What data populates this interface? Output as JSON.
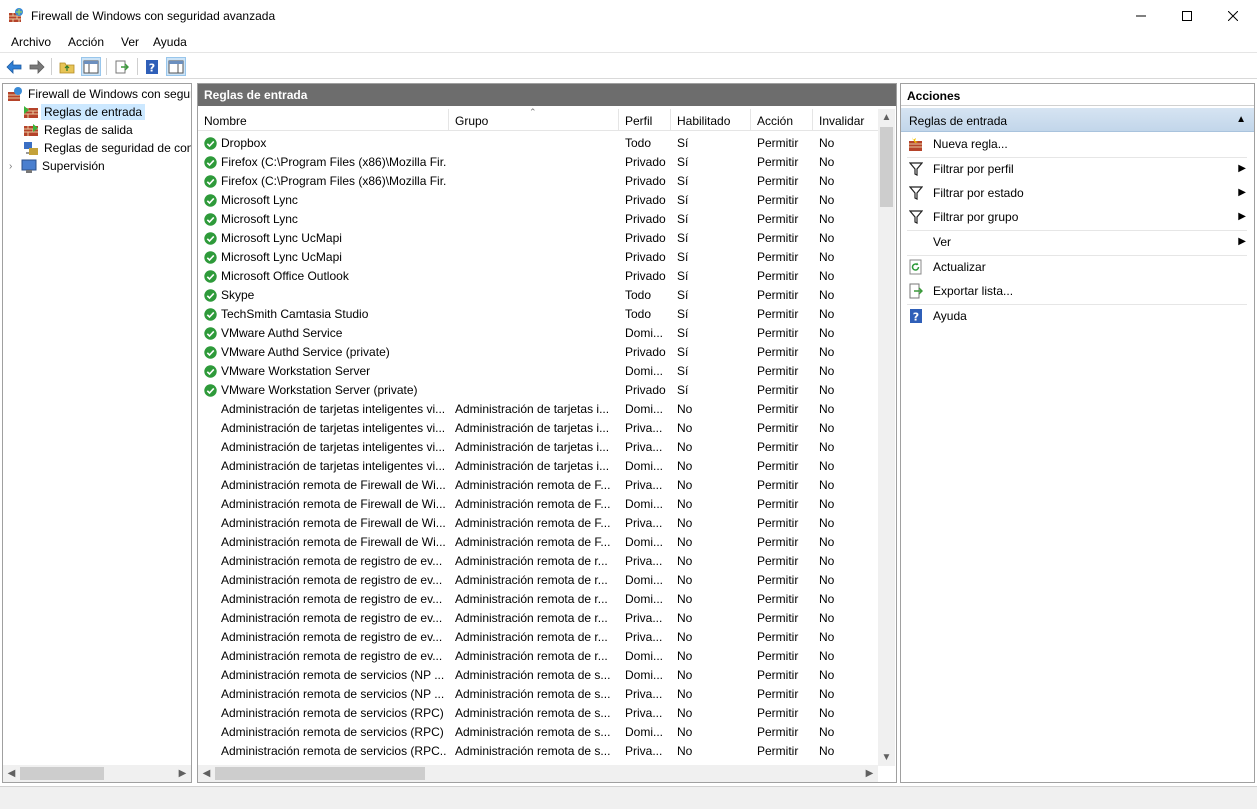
{
  "window": {
    "title": "Firewall de Windows con seguridad avanzada"
  },
  "menu": [
    "Archivo",
    "Acción",
    "Ver",
    "Ayuda"
  ],
  "tree": {
    "root": "Firewall de Windows con segur",
    "items": [
      "Reglas de entrada",
      "Reglas de salida",
      "Reglas de seguridad de con",
      "Supervisión"
    ]
  },
  "center": {
    "header": "Reglas de entrada",
    "columns": [
      "Nombre",
      "Grupo",
      "Perfil",
      "Habilitado",
      "Acción",
      "Invalidar"
    ],
    "rows": [
      {
        "enabled": true,
        "name": "Dropbox",
        "group": "",
        "profile": "Todo",
        "enabled_text": "Sí",
        "action": "Permitir",
        "override": "No"
      },
      {
        "enabled": true,
        "name": "Firefox (C:\\Program Files (x86)\\Mozilla Fir...",
        "group": "",
        "profile": "Privado",
        "enabled_text": "Sí",
        "action": "Permitir",
        "override": "No"
      },
      {
        "enabled": true,
        "name": "Firefox (C:\\Program Files (x86)\\Mozilla Fir...",
        "group": "",
        "profile": "Privado",
        "enabled_text": "Sí",
        "action": "Permitir",
        "override": "No"
      },
      {
        "enabled": true,
        "name": "Microsoft Lync",
        "group": "",
        "profile": "Privado",
        "enabled_text": "Sí",
        "action": "Permitir",
        "override": "No"
      },
      {
        "enabled": true,
        "name": "Microsoft Lync",
        "group": "",
        "profile": "Privado",
        "enabled_text": "Sí",
        "action": "Permitir",
        "override": "No"
      },
      {
        "enabled": true,
        "name": "Microsoft Lync UcMapi",
        "group": "",
        "profile": "Privado",
        "enabled_text": "Sí",
        "action": "Permitir",
        "override": "No"
      },
      {
        "enabled": true,
        "name": "Microsoft Lync UcMapi",
        "group": "",
        "profile": "Privado",
        "enabled_text": "Sí",
        "action": "Permitir",
        "override": "No"
      },
      {
        "enabled": true,
        "name": "Microsoft Office Outlook",
        "group": "",
        "profile": "Privado",
        "enabled_text": "Sí",
        "action": "Permitir",
        "override": "No"
      },
      {
        "enabled": true,
        "name": "Skype",
        "group": "",
        "profile": "Todo",
        "enabled_text": "Sí",
        "action": "Permitir",
        "override": "No"
      },
      {
        "enabled": true,
        "name": "TechSmith Camtasia Studio",
        "group": "",
        "profile": "Todo",
        "enabled_text": "Sí",
        "action": "Permitir",
        "override": "No"
      },
      {
        "enabled": true,
        "name": "VMware Authd Service",
        "group": "",
        "profile": "Domi...",
        "enabled_text": "Sí",
        "action": "Permitir",
        "override": "No"
      },
      {
        "enabled": true,
        "name": "VMware Authd Service (private)",
        "group": "",
        "profile": "Privado",
        "enabled_text": "Sí",
        "action": "Permitir",
        "override": "No"
      },
      {
        "enabled": true,
        "name": "VMware Workstation Server",
        "group": "",
        "profile": "Domi...",
        "enabled_text": "Sí",
        "action": "Permitir",
        "override": "No"
      },
      {
        "enabled": true,
        "name": "VMware Workstation Server (private)",
        "group": "",
        "profile": "Privado",
        "enabled_text": "Sí",
        "action": "Permitir",
        "override": "No"
      },
      {
        "enabled": false,
        "name": "Administración de tarjetas inteligentes vi...",
        "group": "Administración de tarjetas i...",
        "profile": "Domi...",
        "enabled_text": "No",
        "action": "Permitir",
        "override": "No"
      },
      {
        "enabled": false,
        "name": "Administración de tarjetas inteligentes vi...",
        "group": "Administración de tarjetas i...",
        "profile": "Priva...",
        "enabled_text": "No",
        "action": "Permitir",
        "override": "No"
      },
      {
        "enabled": false,
        "name": "Administración de tarjetas inteligentes vi...",
        "group": "Administración de tarjetas i...",
        "profile": "Priva...",
        "enabled_text": "No",
        "action": "Permitir",
        "override": "No"
      },
      {
        "enabled": false,
        "name": "Administración de tarjetas inteligentes vi...",
        "group": "Administración de tarjetas i...",
        "profile": "Domi...",
        "enabled_text": "No",
        "action": "Permitir",
        "override": "No"
      },
      {
        "enabled": false,
        "name": "Administración remota de Firewall de Wi...",
        "group": "Administración remota de F...",
        "profile": "Priva...",
        "enabled_text": "No",
        "action": "Permitir",
        "override": "No"
      },
      {
        "enabled": false,
        "name": "Administración remota de Firewall de Wi...",
        "group": "Administración remota de F...",
        "profile": "Domi...",
        "enabled_text": "No",
        "action": "Permitir",
        "override": "No"
      },
      {
        "enabled": false,
        "name": "Administración remota de Firewall de Wi...",
        "group": "Administración remota de F...",
        "profile": "Priva...",
        "enabled_text": "No",
        "action": "Permitir",
        "override": "No"
      },
      {
        "enabled": false,
        "name": "Administración remota de Firewall de Wi...",
        "group": "Administración remota de F...",
        "profile": "Domi...",
        "enabled_text": "No",
        "action": "Permitir",
        "override": "No"
      },
      {
        "enabled": false,
        "name": "Administración remota de registro de ev...",
        "group": "Administración remota de r...",
        "profile": "Priva...",
        "enabled_text": "No",
        "action": "Permitir",
        "override": "No"
      },
      {
        "enabled": false,
        "name": "Administración remota de registro de ev...",
        "group": "Administración remota de r...",
        "profile": "Domi...",
        "enabled_text": "No",
        "action": "Permitir",
        "override": "No"
      },
      {
        "enabled": false,
        "name": "Administración remota de registro de ev...",
        "group": "Administración remota de r...",
        "profile": "Domi...",
        "enabled_text": "No",
        "action": "Permitir",
        "override": "No"
      },
      {
        "enabled": false,
        "name": "Administración remota de registro de ev...",
        "group": "Administración remota de r...",
        "profile": "Priva...",
        "enabled_text": "No",
        "action": "Permitir",
        "override": "No"
      },
      {
        "enabled": false,
        "name": "Administración remota de registro de ev...",
        "group": "Administración remota de r...",
        "profile": "Priva...",
        "enabled_text": "No",
        "action": "Permitir",
        "override": "No"
      },
      {
        "enabled": false,
        "name": "Administración remota de registro de ev...",
        "group": "Administración remota de r...",
        "profile": "Domi...",
        "enabled_text": "No",
        "action": "Permitir",
        "override": "No"
      },
      {
        "enabled": false,
        "name": "Administración remota de servicios (NP ...",
        "group": "Administración remota de s...",
        "profile": "Domi...",
        "enabled_text": "No",
        "action": "Permitir",
        "override": "No"
      },
      {
        "enabled": false,
        "name": "Administración remota de servicios (NP ...",
        "group": "Administración remota de s...",
        "profile": "Priva...",
        "enabled_text": "No",
        "action": "Permitir",
        "override": "No"
      },
      {
        "enabled": false,
        "name": "Administración remota de servicios (RPC)",
        "group": "Administración remota de s...",
        "profile": "Priva...",
        "enabled_text": "No",
        "action": "Permitir",
        "override": "No"
      },
      {
        "enabled": false,
        "name": "Administración remota de servicios (RPC)",
        "group": "Administración remota de s...",
        "profile": "Domi...",
        "enabled_text": "No",
        "action": "Permitir",
        "override": "No"
      },
      {
        "enabled": false,
        "name": "Administración remota de servicios (RPC...",
        "group": "Administración remota de s...",
        "profile": "Priva...",
        "enabled_text": "No",
        "action": "Permitir",
        "override": "No"
      }
    ]
  },
  "actions": {
    "title": "Acciones",
    "section": "Reglas de entrada",
    "items": [
      {
        "label": "Nueva regla...",
        "icon": "new-rule-icon",
        "submenu": false
      },
      {
        "label": "Filtrar por perfil",
        "icon": "filter-icon",
        "submenu": true
      },
      {
        "label": "Filtrar por estado",
        "icon": "filter-icon",
        "submenu": true
      },
      {
        "label": "Filtrar por grupo",
        "icon": "filter-icon",
        "submenu": true
      },
      {
        "label": "Ver",
        "icon": "",
        "submenu": true
      },
      {
        "label": "Actualizar",
        "icon": "refresh-icon",
        "submenu": false
      },
      {
        "label": "Exportar lista...",
        "icon": "export-icon",
        "submenu": false
      },
      {
        "label": "Ayuda",
        "icon": "help-icon",
        "submenu": false
      }
    ]
  },
  "colors": {
    "accent_selected": "#cce8ff",
    "header_bar": "#6d6d6d",
    "check_green": "#2e9a3a"
  }
}
